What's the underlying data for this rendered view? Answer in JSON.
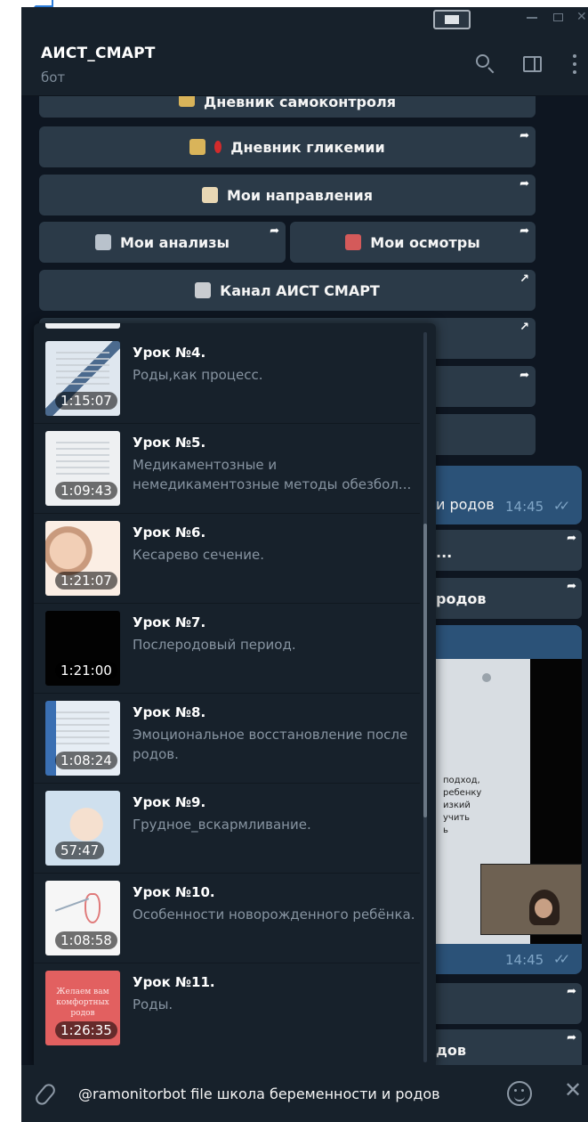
{
  "chat": {
    "title": "АИСТ_СМАРТ",
    "subtitle": "бот"
  },
  "keyboard": [
    {
      "label": "Дневник самоконтроля",
      "emoji_color": "#d9b45a"
    },
    {
      "label": "Дневник гликемии",
      "emoji_color": "#d9b45a"
    },
    {
      "label": "Мои направления",
      "emoji_color": "#e8d7b4"
    },
    {
      "label": "Мои анализы",
      "emoji_color": "#b9c2cc"
    },
    {
      "label": "Мои осмотры",
      "emoji_color": "#d45a5a"
    },
    {
      "label": "Канал АИСТ СМАРТ",
      "emoji_color": "#c9ccd0"
    }
  ],
  "messages": {
    "bubble1_fragment": "и родов",
    "bubble1_time": "14:45",
    "button_fragment_1": "...",
    "button_fragment_2": "родов",
    "video_caption_lines": [
      "подход,",
      "ребенку",
      "изкий",
      "",
      "учить",
      "ь"
    ],
    "bubble2_time": "14:45",
    "button_fragment_3": "дов"
  },
  "lessons": [
    {
      "title": "Урок №4.",
      "description": "Роды,как процесс.",
      "duration": "1:15:07",
      "thumb_style": "blueish"
    },
    {
      "title": "Урок №5.",
      "description": "Медикаментозные и немедикаментозные методы обезбол...",
      "duration": "1:09:43",
      "thumb_style": "white"
    },
    {
      "title": "Урок №6.",
      "description": "Кесарево сечение.",
      "duration": "1:21:07",
      "thumb_style": "baby"
    },
    {
      "title": "Урок №7.",
      "description": "Послеродовый период.",
      "duration": "1:21:00",
      "thumb_style": "black"
    },
    {
      "title": "Урок №8.",
      "description": "Эмоциональное восстановление после родов.",
      "duration": "1:08:24",
      "thumb_style": "sheet"
    },
    {
      "title": "Урок №9.",
      "description": "Грудное_вскармливание.",
      "duration": "57:47",
      "thumb_style": "sleep"
    },
    {
      "title": "Урок №10.",
      "description": "Особенности новорожденного ребёнка.",
      "duration": "1:08:58",
      "thumb_style": "draw"
    },
    {
      "title": "Урок №11.",
      "description": "Роды.",
      "duration": "1:26:35",
      "thumb_style": "red",
      "thumb_text": "Желаем вам комфортных родов"
    }
  ],
  "input": {
    "value": "@ramonitorbot file школа беременности и родов"
  },
  "colors": {
    "background": "#0e1621",
    "header": "#17212b",
    "keyboard_button": "#2b3a48",
    "outgoing_bubble": "#2b5278",
    "accent_text": "#8794a1"
  },
  "icons": [
    "search-icon",
    "side-panel-icon",
    "more-icon",
    "attach-icon",
    "emoji-icon",
    "close-icon",
    "forward-arrow-icon"
  ]
}
